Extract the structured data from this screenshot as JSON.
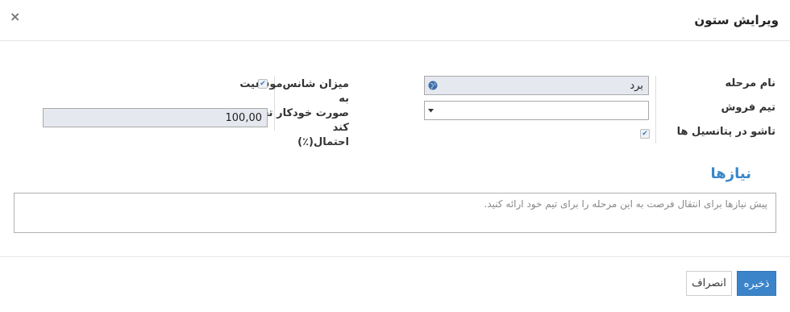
{
  "dialog": {
    "title": "ویرایش ستون",
    "close_glyph": "×"
  },
  "form": {
    "stage_name": {
      "label": "نام مرحله",
      "value": "برد"
    },
    "sales_team": {
      "label": "تیم فروش",
      "value": ""
    },
    "fold_in_pipeline": {
      "label": "تاشو در پتانسیل ها",
      "checked": true
    },
    "auto_probability": {
      "label_lines": [
        "میزان شانس‌موفقیت به",
        "صورت خودکار تغییر کند",
        "احتمال(٪)"
      ],
      "checked": true
    },
    "probability": {
      "value": "100,00"
    }
  },
  "requirements": {
    "heading": "نیازها",
    "placeholder": "پیش نیازها برای انتقال فرصت به این مرحله را برای تیم خود ارائه کنید."
  },
  "footer": {
    "save_label": "ذخیره",
    "cancel_label": "انصراف"
  },
  "colors": {
    "accent": "#3b84c9",
    "heading": "#3a87c8",
    "readonly_field": "#e5e8ee"
  },
  "icons": {
    "check": "✔",
    "globe": "globe-icon",
    "dropdown": "caret-down-icon"
  }
}
